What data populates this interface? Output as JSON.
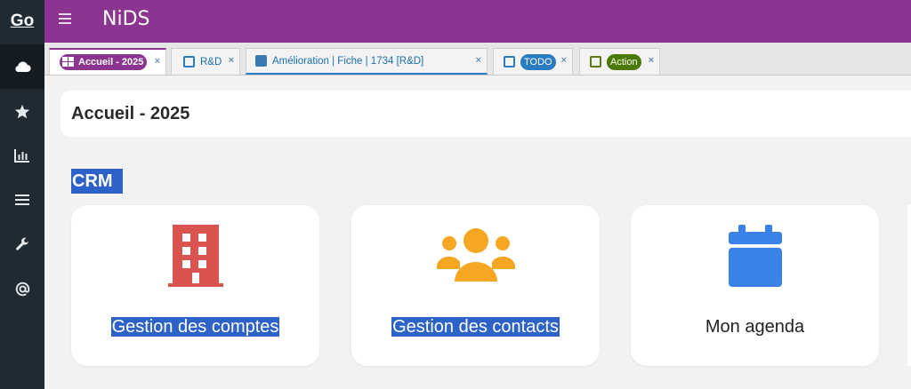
{
  "rail": {
    "logo": "Go",
    "items": [
      {
        "icon": "cloud-icon"
      },
      {
        "icon": "star-icon"
      },
      {
        "icon": "chart-icon"
      },
      {
        "icon": "list-icon"
      },
      {
        "icon": "wrench-icon"
      },
      {
        "icon": "at-icon"
      }
    ]
  },
  "topbar": {
    "app_title": "NiDS"
  },
  "tabs": [
    {
      "label": "Accueil - 2025",
      "close": "×"
    },
    {
      "label": "R&D",
      "close": "×"
    },
    {
      "label": "Amélioration | Fiche | 1734 [R&D]",
      "close": "×"
    },
    {
      "label": "TODO",
      "close": "×"
    },
    {
      "label": "Action",
      "close": "×"
    }
  ],
  "page": {
    "title": "Accueil - 2025",
    "section": "CRM"
  },
  "cards": [
    {
      "label": "Gestion des comptes",
      "icon": "building-icon",
      "color": "#d9534f"
    },
    {
      "label": "Gestion des contacts",
      "icon": "users-icon",
      "color": "#f5a623"
    },
    {
      "label": "Mon agenda",
      "icon": "calendar-icon",
      "color": "#3b82e6"
    }
  ],
  "colors": {
    "brand": "#8b3590",
    "rail": "#1f2a33",
    "selection": "#2d62c8"
  }
}
